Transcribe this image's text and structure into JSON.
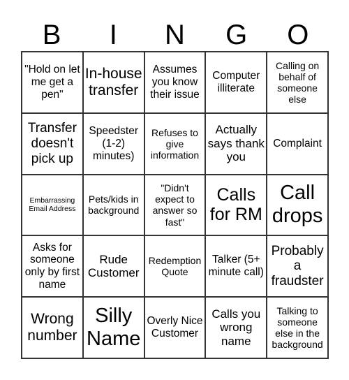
{
  "header": {
    "letters": [
      "B",
      "I",
      "N",
      "G",
      "O"
    ]
  },
  "cells": [
    [
      "\"Hold on let me get a pen\"",
      "In-house transfer",
      "Assumes you know their issue",
      "Computer illiterate",
      "Calling on behalf of someone else"
    ],
    [
      "Transfer doesn't pick up",
      "Speedster (1-2) minutes)",
      "Refuses to give information",
      "Actually says thank you",
      "Complaint"
    ],
    [
      "Embarrassing Email Address",
      "Pets/kids in background",
      "\"Didn't expect to answer so fast\"",
      "Calls for RM",
      "Call drops"
    ],
    [
      "Asks for someone only by first name",
      "Rude Customer",
      "Redemption Quote",
      "Talker (5+ minute call)",
      "Probably a fraudster"
    ],
    [
      "Wrong number",
      "Silly Name",
      "Overly Nice Customer",
      "Calls you wrong name",
      "Talking to someone else in the background"
    ]
  ]
}
